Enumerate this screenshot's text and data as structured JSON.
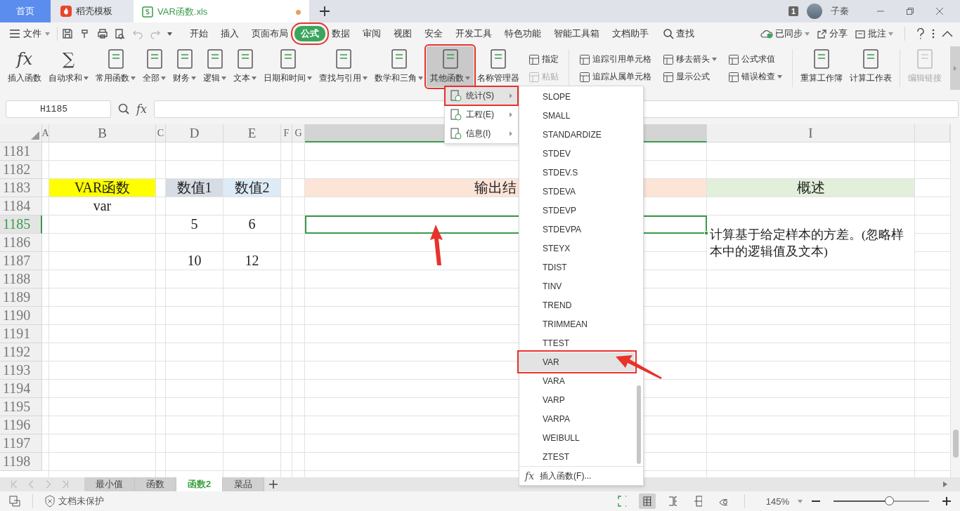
{
  "tab_bar": {
    "tabs": [
      {
        "label": "首页",
        "kind": "home",
        "selected": false
      },
      {
        "label": "稻壳模板",
        "kind": "docer",
        "selected": false
      },
      {
        "label": "VAR函数.xls",
        "kind": "sheet",
        "selected": true,
        "unsaved": true
      }
    ],
    "badge": "1",
    "user": "子秦"
  },
  "menu_bar": {
    "file": "文件",
    "tabs": [
      {
        "label": "开始",
        "selected": false
      },
      {
        "label": "插入",
        "selected": false
      },
      {
        "label": "页面布局",
        "selected": false
      },
      {
        "label": "公式",
        "selected": true,
        "highlighted": true
      },
      {
        "label": "数据",
        "selected": false
      },
      {
        "label": "审阅",
        "selected": false
      },
      {
        "label": "视图",
        "selected": false
      },
      {
        "label": "安全",
        "selected": false
      },
      {
        "label": "开发工具",
        "selected": false
      },
      {
        "label": "特色功能",
        "selected": false
      },
      {
        "label": "智能工具箱",
        "selected": false
      },
      {
        "label": "文档助手",
        "selected": false
      }
    ],
    "search": "查找",
    "actions": [
      {
        "label": "已同步",
        "kind": "sync",
        "dropdown": true
      },
      {
        "label": "分享",
        "kind": "share"
      },
      {
        "label": "批注",
        "kind": "comment",
        "dropdown": true
      }
    ]
  },
  "ribbon": [
    {
      "kind": "large",
      "label": "插入函数",
      "glyph": "fx"
    },
    {
      "kind": "large",
      "label": "自动求和",
      "glyph": "∑",
      "dropdown": true
    },
    {
      "kind": "large",
      "label": "常用函数",
      "dropdown": true
    },
    {
      "kind": "large",
      "label": "全部",
      "dropdown": true
    },
    {
      "kind": "large",
      "label": "财务",
      "dropdown": true
    },
    {
      "kind": "large",
      "label": "逻辑",
      "dropdown": true
    },
    {
      "kind": "large",
      "label": "文本",
      "dropdown": true
    },
    {
      "kind": "large",
      "label": "日期和时间",
      "dropdown": true
    },
    {
      "kind": "large",
      "label": "查找与引用",
      "dropdown": true
    },
    {
      "kind": "large",
      "label": "数学和三角",
      "dropdown": true
    },
    {
      "kind": "large",
      "label": "其他函数",
      "dropdown": true,
      "pressed": true,
      "highlighted": true
    },
    {
      "kind": "large",
      "label": "名称管理器"
    },
    {
      "kind": "stack",
      "items": [
        {
          "label": "指定"
        },
        {
          "label": "粘贴",
          "disabled": true
        }
      ]
    },
    {
      "kind": "separator"
    },
    {
      "kind": "stack",
      "items": [
        {
          "label": "追踪引用单元格"
        },
        {
          "label": "追踪从属单元格"
        }
      ]
    },
    {
      "kind": "stack",
      "items": [
        {
          "label": "移去箭头",
          "dropdown": true
        },
        {
          "label": "显示公式"
        }
      ]
    },
    {
      "kind": "stack",
      "items": [
        {
          "label": "公式求值"
        },
        {
          "label": "错误检查",
          "dropdown": true
        }
      ]
    },
    {
      "kind": "separator"
    },
    {
      "kind": "large",
      "label": "重算工作簿"
    },
    {
      "kind": "large",
      "label": "计算工作表"
    },
    {
      "kind": "separator"
    },
    {
      "kind": "large",
      "label": "编辑链接",
      "disabled": true
    }
  ],
  "formula_bar": {
    "name_box": "H1185",
    "fx": "fx"
  },
  "sheet": {
    "columns": [
      {
        "label": "A",
        "selected": false
      },
      {
        "label": "B",
        "selected": false
      },
      {
        "label": "C",
        "selected": false
      },
      {
        "label": "D",
        "selected": false
      },
      {
        "label": "E",
        "selected": false
      },
      {
        "label": "F",
        "selected": false
      },
      {
        "label": "G",
        "selected": false
      },
      {
        "selected": true
      },
      {
        "label": "I",
        "selected": false
      }
    ],
    "rows": [
      {
        "header": "1181",
        "selected": false
      },
      {
        "header": "1182",
        "selected": false
      },
      {
        "header": "1183",
        "selected": false,
        "cells": [
          {},
          {
            "text": "VAR函数",
            "color": "#ffff00"
          },
          {},
          {
            "text": "数值1",
            "color": "#d6dce4"
          },
          {
            "text": "数值2",
            "color": "#ddebf7"
          },
          {},
          {},
          {
            "text": "输出结",
            "color": "#fce4d6"
          },
          {
            "text": "概述",
            "color": "#e2efda"
          }
        ]
      },
      {
        "header": "1184",
        "selected": false,
        "cells": [
          {},
          {
            "text": "var"
          },
          {},
          {},
          {},
          {},
          {},
          {},
          {}
        ]
      },
      {
        "header": "1185",
        "selected": true,
        "cells": [
          {},
          {},
          {},
          {
            "text": "5"
          },
          {
            "text": "6"
          },
          {},
          {},
          {
            "selected": true
          },
          {
            "text": "计算基于给定样本的方差。(忽略样本中的逻辑值及文本)",
            "merged": true
          }
        ]
      },
      {
        "header": "1186",
        "selected": false
      },
      {
        "header": "1187",
        "selected": false,
        "cells": [
          {},
          {},
          {},
          {
            "text": "10"
          },
          {
            "text": "12"
          },
          {},
          {},
          {},
          {}
        ]
      },
      {
        "header": "1188",
        "selected": false
      },
      {
        "header": "1189",
        "selected": false
      },
      {
        "header": "1190",
        "selected": false
      },
      {
        "header": "1191",
        "selected": false
      },
      {
        "header": "1192",
        "selected": false
      },
      {
        "header": "1193",
        "selected": false
      },
      {
        "header": "1194",
        "selected": false
      },
      {
        "header": "1195",
        "selected": false
      },
      {
        "header": "1196",
        "selected": false
      },
      {
        "header": "1197",
        "selected": false
      },
      {
        "header": "1198",
        "selected": false
      }
    ]
  },
  "sheet_tabs": [
    {
      "label": "最小值",
      "selected": false
    },
    {
      "label": "函数",
      "selected": false
    },
    {
      "label": "函数2",
      "selected": true
    },
    {
      "label": "菜品",
      "selected": false
    }
  ],
  "status_bar": {
    "protection": "文档未保护",
    "zoom": "145%",
    "zoom_slider": {
      "level": 0.58
    }
  },
  "menu": {
    "items": [
      {
        "label": "统计(S)",
        "selected": true,
        "highlighted": true
      },
      {
        "label": "工程(E)",
        "selected": false
      },
      {
        "label": "信息(I)",
        "selected": false
      }
    ],
    "submenu": {
      "items": [
        {
          "label": "SLOPE",
          "selected": false
        },
        {
          "label": "SMALL",
          "selected": false
        },
        {
          "label": "STANDARDIZE",
          "selected": false
        },
        {
          "label": "STDEV",
          "selected": false
        },
        {
          "label": "STDEV.S",
          "selected": false
        },
        {
          "label": "STDEVA",
          "selected": false
        },
        {
          "label": "STDEVP",
          "selected": false
        },
        {
          "label": "STDEVPA",
          "selected": false
        },
        {
          "label": "STEYX",
          "selected": false
        },
        {
          "label": "TDIST",
          "selected": false
        },
        {
          "label": "TINV",
          "selected": false
        },
        {
          "label": "TREND",
          "selected": false
        },
        {
          "label": "TRIMMEAN",
          "selected": false
        },
        {
          "label": "TTEST",
          "selected": false
        },
        {
          "label": "VAR",
          "selected": true,
          "highlighted": true
        },
        {
          "label": "VARA",
          "selected": false
        },
        {
          "label": "VARP",
          "selected": false
        },
        {
          "label": "VARPA",
          "selected": false
        },
        {
          "label": "WEIBULL",
          "selected": false
        },
        {
          "label": "ZTEST",
          "selected": false
        }
      ],
      "footer": {
        "glyph": "fx",
        "label": "插入函数(F)..."
      }
    }
  }
}
